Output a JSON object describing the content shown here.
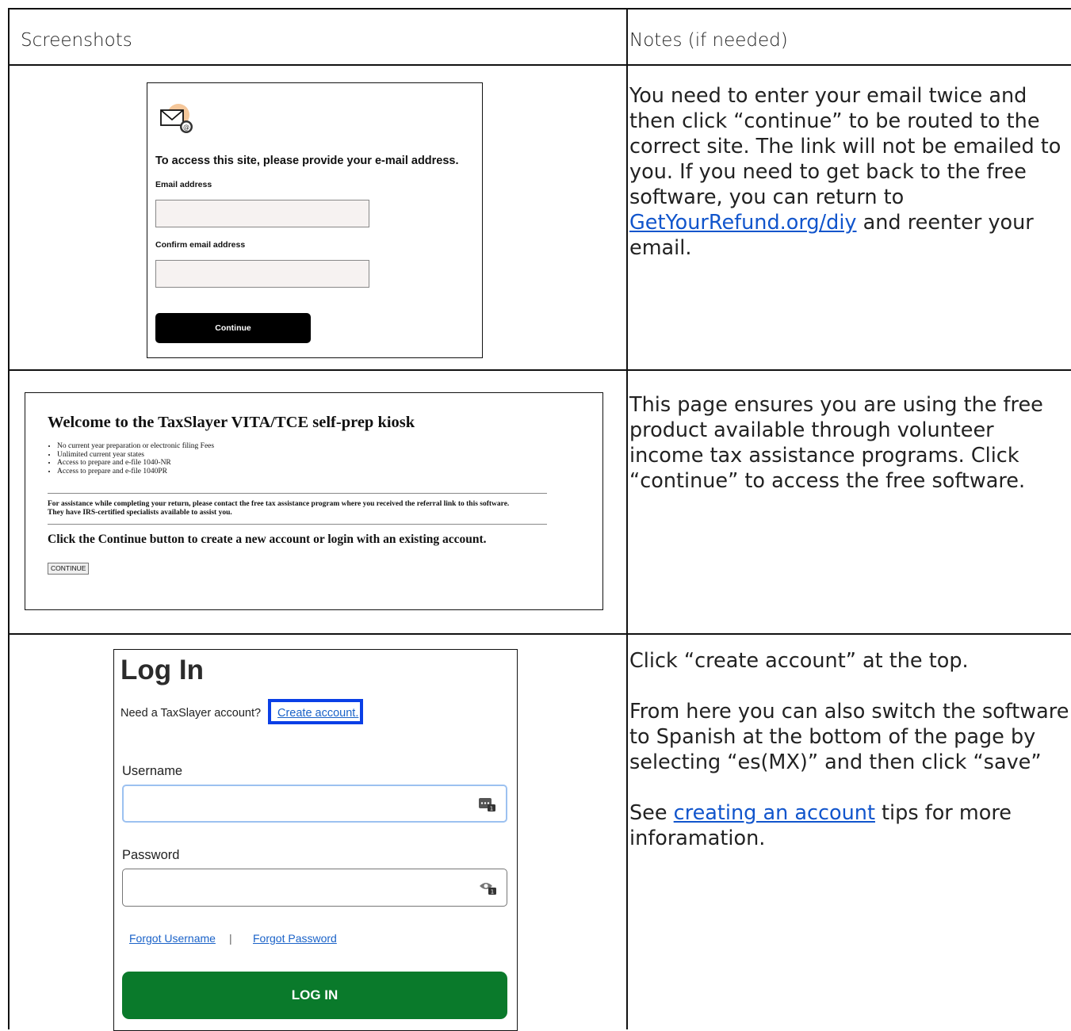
{
  "table": {
    "headers": {
      "screenshots": "Screenshots",
      "notes": "Notes (if needed)"
    },
    "rows": [
      {
        "note": {
          "text_before_link": "You need to enter your email twice and then click “continue” to be routed to the correct site. The link will not be emailed to you. If you need to get back to the free software, you can return to ",
          "link": "GetYourRefund.org/diy",
          "text_after_link": " and reenter your email."
        }
      },
      {
        "note": {
          "text": "This page ensures you are using the free product available through volunteer income tax assistance programs. Click “continue” to access the free software."
        }
      },
      {
        "note": {
          "p1": "Click “create account” at the top.",
          "p2": "From here you can also switch the software to Spanish at the bottom of the page by selecting “es(MX)” and then click “save”",
          "p3_before_link": "See ",
          "p3_link": "creating an account",
          "p3_after_link": " tips for more inforamation."
        }
      }
    ]
  },
  "email_screen": {
    "title": "To access this site, please provide your e-mail address.",
    "email_label": "Email address",
    "confirm_label": "Confirm email address",
    "continue_label": "Continue",
    "icon": "envelope-at-icon",
    "icon_accent": "#f5c79a"
  },
  "kiosk_screen": {
    "title": "Welcome to the TaxSlayer VITA/TCE self-prep kiosk",
    "bullets": [
      "No current year preparation or electronic filing Fees",
      "Unlimited current year states",
      "Access to prepare and e-file 1040-NR",
      "Access to prepare and e-file 1040PR"
    ],
    "assist_line1": "For assistance while completing your return, please contact the free tax assistance program where you received the referral link to this software.",
    "assist_line2": "They have IRS-certified specialists available to assist you.",
    "instruction": "Click the Continue button to create a new account or login with an existing account.",
    "continue_button": "CONTINUE"
  },
  "login_screen": {
    "title": "Log In",
    "need_account": "Need a TaxSlayer account?",
    "create_account": "Create account.",
    "username_label": "Username",
    "password_label": "Password",
    "forgot_username": "Forgot Username",
    "separator": "|",
    "forgot_password": "Forgot Password",
    "login_button": "LOG IN",
    "highlight_color": "#0a3fe6",
    "button_color": "#0a7a2b"
  }
}
